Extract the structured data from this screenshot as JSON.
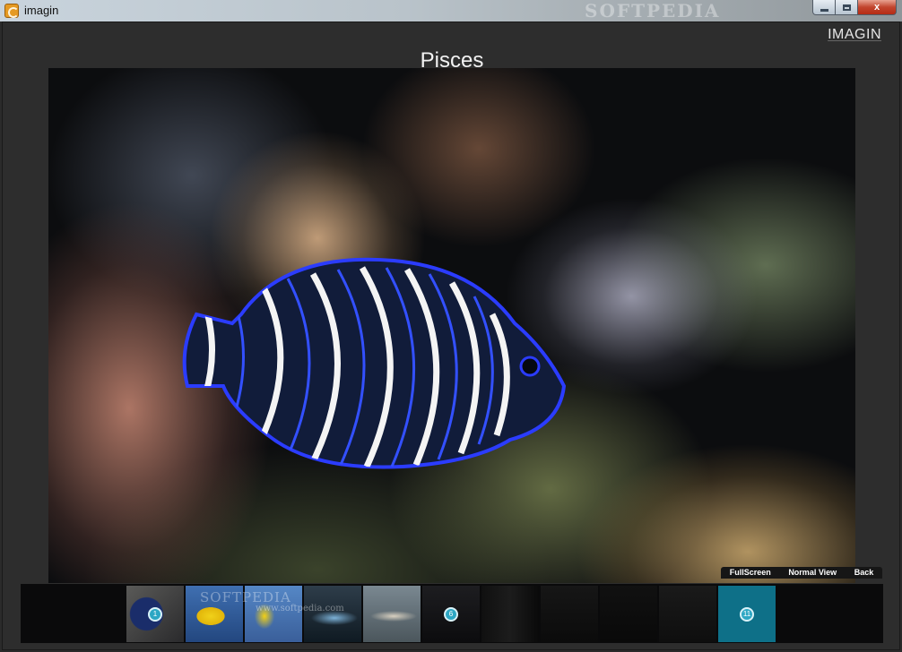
{
  "window": {
    "title": "imagin",
    "watermark": "SOFTPEDIA",
    "controls": {
      "minimize": "minimize",
      "maximize": "maximize",
      "close": "x"
    }
  },
  "app": {
    "brand": "IMAGIN",
    "photo_title": "Pisces"
  },
  "view_buttons": {
    "fullscreen": "FullScreen",
    "normal_view": "Normal View",
    "back": "Back"
  },
  "thumbnails": {
    "watermark": "SOFTPEDIA",
    "watermark_sub": "www.softpedia.com",
    "items": [
      {
        "index": "1",
        "badge": "1"
      },
      {
        "index": "2",
        "badge": ""
      },
      {
        "index": "3",
        "badge": ""
      },
      {
        "index": "4",
        "badge": ""
      },
      {
        "index": "5",
        "badge": ""
      },
      {
        "index": "6",
        "badge": "6"
      },
      {
        "index": "7",
        "badge": ""
      },
      {
        "index": "8",
        "badge": ""
      },
      {
        "index": "9",
        "badge": ""
      },
      {
        "index": "10",
        "badge": ""
      },
      {
        "index": "11",
        "badge": "11"
      }
    ]
  },
  "colors": {
    "accent": "#0e7088",
    "badge": "#2da7c4",
    "frame": "#2d2d2d"
  },
  "icons": {
    "app": "app-logo-icon",
    "minimize": "minimize-icon",
    "maximize": "maximize-icon",
    "close": "close-icon"
  }
}
